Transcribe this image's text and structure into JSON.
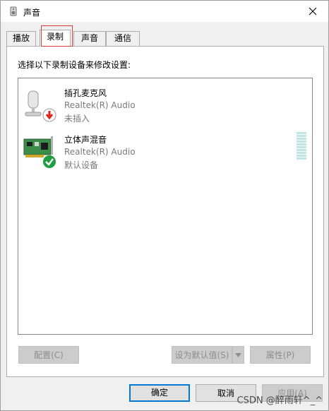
{
  "window": {
    "title": "声音"
  },
  "tabs": [
    {
      "label": "播放",
      "active": false
    },
    {
      "label": "录制",
      "active": true
    },
    {
      "label": "声音",
      "active": false
    },
    {
      "label": "通信",
      "active": false
    }
  ],
  "panel": {
    "instruction": "选择以下录制设备来修改设置:",
    "devices": [
      {
        "name": "插孔麦克风",
        "driver": "Realtek(R) Audio",
        "status": "未插入",
        "icon": "microphone-icon",
        "badge": "down-arrow-badge"
      },
      {
        "name": "立体声混音",
        "driver": "Realtek(R) Audio",
        "status": "默认设备",
        "icon": "sound-card-icon",
        "badge": "check-badge"
      }
    ],
    "buttons": {
      "configure": "配置(C)",
      "set_default": "设为默认值(S)",
      "properties": "属性(P)"
    }
  },
  "footer": {
    "ok": "确定",
    "cancel": "取消",
    "apply": "应用(A)"
  },
  "watermark": "CSDN @醉雨轩^_^",
  "colors": {
    "annotation_red": "#e83a3a",
    "accent_blue": "#0078d7",
    "check_green": "#1e9e3e"
  }
}
